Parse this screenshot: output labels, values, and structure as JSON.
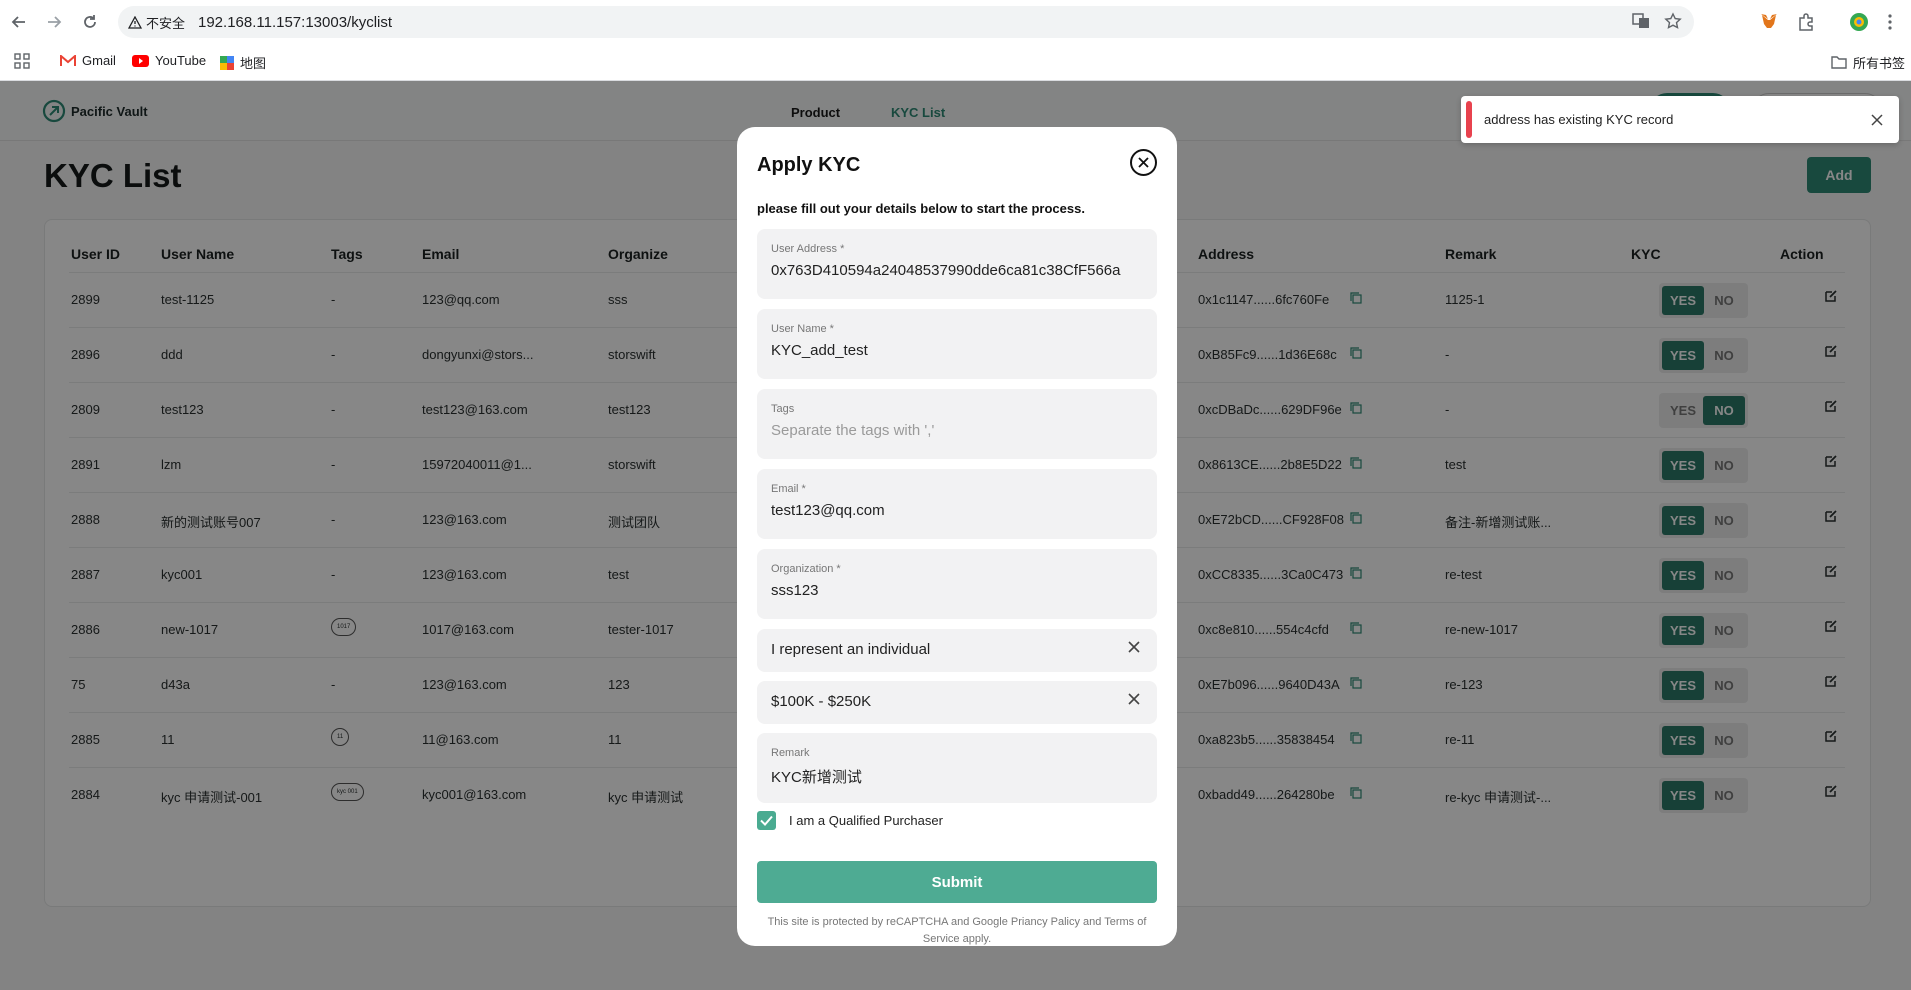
{
  "browser": {
    "security_label": "不安全",
    "url": "192.168.11.157:13003/kyclist",
    "bookmarks": [
      "Gmail",
      "YouTube",
      "地图"
    ],
    "bookmarks_folder": "所有书签"
  },
  "app": {
    "brand": "Pacific Vault",
    "nav": [
      "Product",
      "KYC List"
    ],
    "page_title": "KYC List",
    "add_label": "Add",
    "columns": [
      "User ID",
      "User Name",
      "Tags",
      "Email",
      "Organize",
      "Address",
      "Remark",
      "KYC",
      "Action"
    ],
    "rows": [
      {
        "id": "2899",
        "name": "test-1125",
        "tags": "-",
        "email": "123@qq.com",
        "org": "sss",
        "address": "0x1c1147......6fc760Fe",
        "remark": "1125-1",
        "kyc": "YES"
      },
      {
        "id": "2896",
        "name": "ddd",
        "tags": "-",
        "email": "dongyunxi@stors...",
        "org": "storswift",
        "address": "0xB85Fc9......1d36E68c",
        "remark": "-",
        "kyc": "YES"
      },
      {
        "id": "2809",
        "name": "test123",
        "tags": "-",
        "email": "test123@163.com",
        "org": "test123",
        "address": "0xcDBaDc......629DF96e",
        "remark": "-",
        "kyc": "NO"
      },
      {
        "id": "2891",
        "name": "lzm",
        "tags": "-",
        "email": "15972040011@1...",
        "org": "storswift",
        "address": "0x8613CE......2b8E5D22",
        "remark": "test",
        "kyc": "YES"
      },
      {
        "id": "2888",
        "name": "新的测试账号007",
        "tags": "-",
        "email": "123@163.com",
        "org": "测试团队",
        "address": "0xE72bCD......CF928F08",
        "remark": "备注-新增测试账...",
        "kyc": "YES"
      },
      {
        "id": "2887",
        "name": "kyc001",
        "tags": "-",
        "email": "123@163.com",
        "org": "test",
        "address": "0xCC8335......3Ca0C473",
        "remark": "re-test",
        "kyc": "YES"
      },
      {
        "id": "2886",
        "name": "new-1017",
        "tags": "1017",
        "email": "1017@163.com",
        "org": "tester-1017",
        "address": "0xc8e810......554c4cfd",
        "remark": "re-new-1017",
        "kyc": "YES"
      },
      {
        "id": "75",
        "name": "d43a",
        "tags": "-",
        "email": "123@163.com",
        "org": "123",
        "address": "0xE7b096......9640D43A",
        "remark": "re-123",
        "kyc": "YES"
      },
      {
        "id": "2885",
        "name": "11",
        "tags": "11",
        "email": "11@163.com",
        "org": "11",
        "address": "0xa823b5......35838454",
        "remark": "re-11",
        "kyc": "YES"
      },
      {
        "id": "2884",
        "name": "kyc 申请测试-001",
        "tags": "kyc 001",
        "email": "kyc001@163.com",
        "org": "kyc 申请测试",
        "address": "0xbadd49......264280be",
        "remark": "re-kyc 申请测试-...",
        "kyc": "YES"
      }
    ],
    "yes_label": "YES",
    "no_label": "NO"
  },
  "modal": {
    "title": "Apply KYC",
    "subtitle": "please fill out your details below to start the process.",
    "fields": {
      "address_label": "User Address *",
      "address_value": "0x763D410594a24048537990dde6ca81c38CfF566a",
      "name_label": "User Name *",
      "name_value": "KYC_add_test",
      "tags_label": "Tags",
      "tags_placeholder": "Separate the tags with ','",
      "email_label": "Email *",
      "email_value": "test123@qq.com",
      "org_label": "Organization *",
      "org_value": "sss123",
      "type_value": "I represent an individual",
      "amount_value": "$100K - $250K",
      "remark_label": "Remark",
      "remark_value": "KYC新增测试"
    },
    "checkbox_label": "I am a Qualified Purchaser",
    "submit_label": "Submit",
    "legal": "This site is protected by reCAPTCHA and Google Priancy Palicy and Terms of Service apply."
  },
  "toast": {
    "message": "address has existing KYC record"
  },
  "colors": {
    "accent": "#2f8a76",
    "submit": "#4eab93",
    "error": "#e8424e"
  }
}
